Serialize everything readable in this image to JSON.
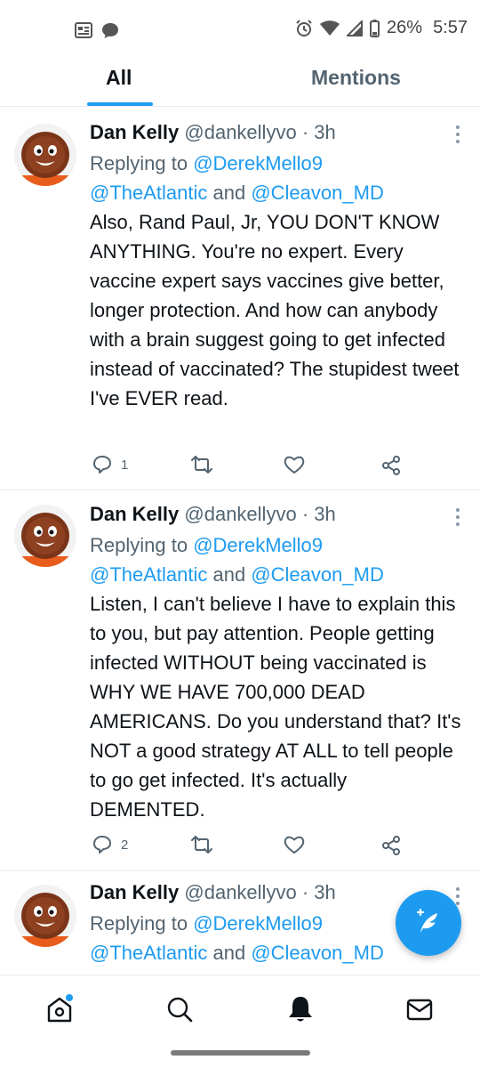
{
  "status_bar": {
    "battery": "26%",
    "time": "5:57"
  },
  "tabs": [
    {
      "label": "All",
      "active": true
    },
    {
      "label": "Mentions",
      "active": false
    }
  ],
  "tweets": [
    {
      "name": "Dan Kelly",
      "handle": "@dankellyvo",
      "sep": "·",
      "time": "3h",
      "replying_prefix": "Replying to ",
      "reply_to_1": "@DerekMello9",
      "reply_to_2": "@TheAtlantic",
      "reply_and": " and ",
      "reply_to_3": "@Cleavon_MD",
      "text": "Also, Rand Paul, Jr, YOU DON'T KNOW ANYTHING. You're no expert. Every vaccine expert says vaccines give better, longer protection. And how can anybody with a brain suggest going to get infected instead of vaccinated? The stupidest tweet I've EVER read.",
      "reply_count": "1",
      "retweet_count": "",
      "like_count": ""
    },
    {
      "name": "Dan Kelly",
      "handle": "@dankellyvo",
      "sep": "·",
      "time": "3h",
      "replying_prefix": "Replying to ",
      "reply_to_1": "@DerekMello9",
      "reply_to_2": "@TheAtlantic",
      "reply_and": " and ",
      "reply_to_3": "@Cleavon_MD",
      "text": "Listen, I can't believe I have to explain this to you, but pay attention. People getting infected WITHOUT being vaccinated is WHY WE HAVE 700,000 DEAD AMERICANS. Do you understand that? It's NOT a good strategy AT ALL to tell people to go get infected. It's actually DEMENTED.",
      "reply_count": "2",
      "retweet_count": "",
      "like_count": ""
    },
    {
      "name": "Dan Kelly",
      "handle": "@dankellyvo",
      "sep": "·",
      "time": "3h",
      "replying_prefix": "Replying to ",
      "reply_to_1": "@DerekMello9",
      "reply_to_2": "@TheAtlantic",
      "reply_and": " and ",
      "reply_to_3": "@Cleavon_MD",
      "text": ""
    }
  ],
  "colors": {
    "accent": "#1d9bf0",
    "text": "#0f1419",
    "muted": "#536471"
  },
  "icons": {
    "nav": [
      "home-icon",
      "search-icon",
      "notifications-icon",
      "messages-icon"
    ],
    "fab": "compose-tweet-icon",
    "actions": [
      "reply-icon",
      "retweet-icon",
      "like-icon",
      "share-icon"
    ]
  }
}
